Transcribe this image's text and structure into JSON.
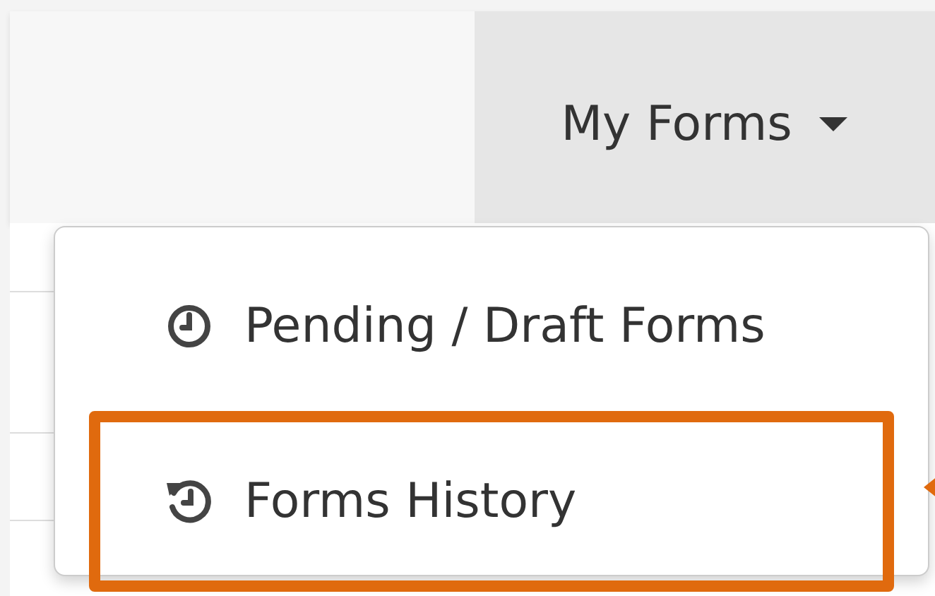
{
  "navbar": {
    "menu_button": {
      "label": "My Forms",
      "expanded": true
    }
  },
  "dropdown": {
    "items": [
      {
        "label": "Pending / Draft Forms",
        "kind": "clock",
        "highlighted": false
      },
      {
        "label": "Forms History",
        "kind": "history",
        "highlighted": true
      }
    ]
  }
}
